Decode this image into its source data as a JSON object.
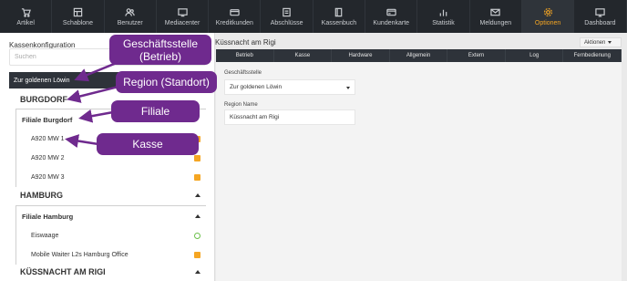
{
  "topnav": [
    {
      "label": "Artikel",
      "icon": "cart-icon"
    },
    {
      "label": "Schablone",
      "icon": "template-icon"
    },
    {
      "label": "Benutzer",
      "icon": "users-icon"
    },
    {
      "label": "Mediacenter",
      "icon": "media-icon"
    },
    {
      "label": "Kreditkunden",
      "icon": "credit-card-icon"
    },
    {
      "label": "Abschlüsse",
      "icon": "closing-icon"
    },
    {
      "label": "Kassenbuch",
      "icon": "cashbook-icon"
    },
    {
      "label": "Kundenkarte",
      "icon": "customer-card-icon"
    },
    {
      "label": "Statistik",
      "icon": "statistics-icon"
    },
    {
      "label": "Meldungen",
      "icon": "messages-icon"
    },
    {
      "label": "Optionen",
      "icon": "gear-icon",
      "active": true
    },
    {
      "label": "Dashboard",
      "icon": "dashboard-icon"
    }
  ],
  "left": {
    "title": "Kassenkonfiguration",
    "search_placeholder": "Suchen",
    "company": "Zur goldenen Löwin",
    "regions": [
      {
        "name": "BURGDORF",
        "filiale": "Filiale Burgdorf",
        "kassen": [
          {
            "name": "A920 MW 1",
            "status": "orange"
          },
          {
            "name": "A920 MW 2",
            "status": "orange"
          },
          {
            "name": "A920 MW 3",
            "status": "orange"
          }
        ]
      },
      {
        "name": "HAMBURG",
        "filiale": "Filiale Hamburg",
        "kassen": [
          {
            "name": "Eiswaage",
            "status": "green"
          },
          {
            "name": "Mobile Waiter L2s Hamburg Office",
            "status": "orange"
          }
        ]
      },
      {
        "name": "KÜSSNACHT AM RIGI"
      }
    ]
  },
  "right": {
    "title": "Küssnacht am Rigi",
    "actions_label": "Aktionen",
    "tabs": [
      "Betrieb",
      "Kasse",
      "Hardware",
      "Allgemein",
      "Extern",
      "Log",
      "Fernbedienung"
    ],
    "fields": {
      "geschaeftsstelle_label": "Geschäftsstelle",
      "geschaeftsstelle_value": "Zur goldenen Löwin",
      "region_label": "Region Name",
      "region_value": "Küssnacht am Rigi"
    }
  },
  "callouts": {
    "geschaeftsstelle": "Geschäftsstelle (Betrieb)",
    "region": "Region (Standort)",
    "filiale": "Filiale",
    "kasse": "Kasse"
  },
  "colors": {
    "nav_bg": "#23272c",
    "accent": "#f5a623",
    "callout": "#6f2a8e",
    "status_orange": "#f5a623",
    "status_green": "#6cc04a"
  }
}
